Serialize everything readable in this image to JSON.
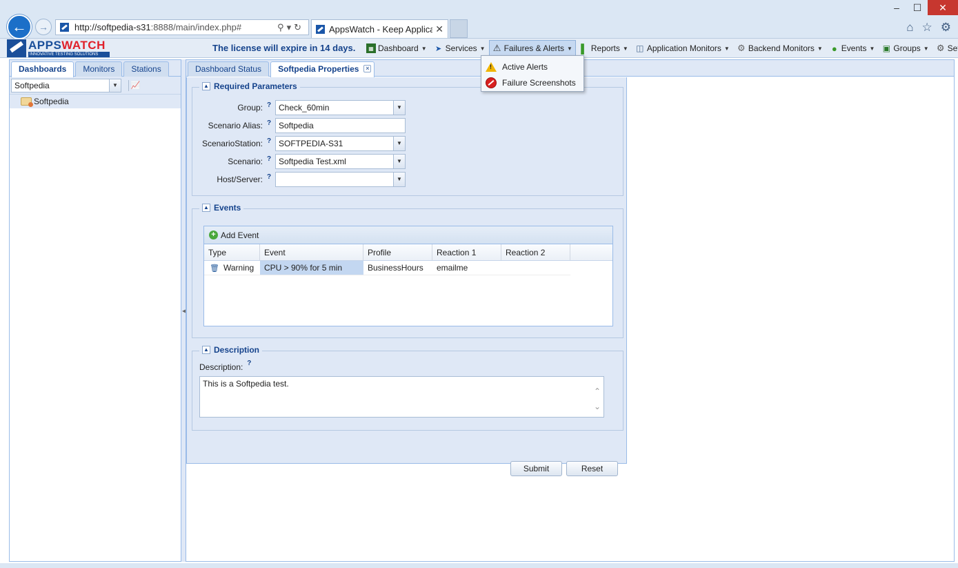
{
  "browser": {
    "url_host": "http://softpedia-s31",
    "url_rest": ":8888/main/index.php#",
    "tab_title": "AppsWatch - Keep Applicat...",
    "window_controls": [
      "–",
      "☐",
      "✕"
    ]
  },
  "app": {
    "logo_prefix": "APPS",
    "logo_suffix": "WATCH",
    "logo_tagline": "INNOVATIVE TESTING SOLUTIONS",
    "license_notice": "The license will expire in 14 days."
  },
  "menus": [
    {
      "label": "Dashboard",
      "icon": "dashboard-icon"
    },
    {
      "label": "Services",
      "icon": "services-icon"
    },
    {
      "label": "Failures & Alerts",
      "icon": "warning-icon"
    },
    {
      "label": "Reports",
      "icon": "reports-icon"
    },
    {
      "label": "Application Monitors",
      "icon": "monitor-icon"
    },
    {
      "label": "Backend Monitors",
      "icon": "gears-icon"
    },
    {
      "label": "Events",
      "icon": "events-icon"
    },
    {
      "label": "Groups",
      "icon": "groups-icon"
    },
    {
      "label": "Setup",
      "icon": "gear-icon"
    }
  ],
  "dropdown": {
    "items": [
      "Active Alerts",
      "Failure Screenshots"
    ]
  },
  "left_panel": {
    "tabs": [
      "Dashboards",
      "Monitors",
      "Stations"
    ],
    "selector_value": "Softpedia",
    "tree_items": [
      "Softpedia"
    ]
  },
  "main_tabs": [
    "Dashboard Status",
    "Softpedia Properties"
  ],
  "required": {
    "legend": "Required Parameters",
    "fields": [
      {
        "label": "Group:",
        "value": "Check_60min"
      },
      {
        "label": "Scenario Alias:",
        "value": "Softpedia"
      },
      {
        "label": "ScenarioStation:",
        "value": "SOFTPEDIA-S31"
      },
      {
        "label": "Scenario:",
        "value": "Softpedia Test.xml"
      },
      {
        "label": "Host/Server:",
        "value": ""
      }
    ]
  },
  "events": {
    "legend": "Events",
    "add_label": "Add Event",
    "columns": [
      "Type",
      "Event",
      "Profile",
      "Reaction 1",
      "Reaction 2"
    ],
    "rows": [
      {
        "type": "Warning",
        "event": "CPU > 90% for 5 min",
        "profile": "BusinessHours",
        "reaction1": "emailme",
        "reaction2": ""
      }
    ]
  },
  "description": {
    "legend": "Description",
    "label": "Description:",
    "value": "This is a Softpedia test."
  },
  "buttons": {
    "submit": "Submit",
    "reset": "Reset"
  },
  "help_glyph": "?"
}
